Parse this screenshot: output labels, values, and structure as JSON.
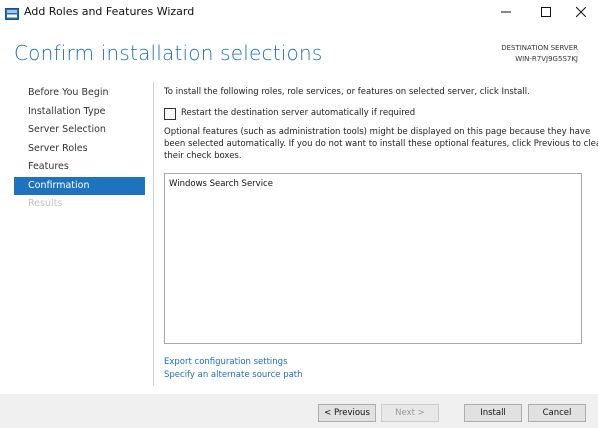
{
  "window": {
    "title": "Add Roles and Features Wizard"
  },
  "header": {
    "page_title": "Confirm installation selections",
    "destination_label": "DESTINATION SERVER",
    "destination_value": "WIN-R7VJ9G5S7KJ"
  },
  "nav": {
    "items": [
      {
        "label": "Before You Begin",
        "state": "normal"
      },
      {
        "label": "Installation Type",
        "state": "normal"
      },
      {
        "label": "Server Selection",
        "state": "normal"
      },
      {
        "label": "Server Roles",
        "state": "normal"
      },
      {
        "label": "Features",
        "state": "normal"
      },
      {
        "label": "Confirmation",
        "state": "active"
      },
      {
        "label": "Results",
        "state": "disabled"
      }
    ]
  },
  "main": {
    "intro": "To install the following roles, role services, or features on selected server, click Install.",
    "restart_label": "Restart the destination server automatically if required",
    "restart_checked": false,
    "note_lines": [
      "Optional features (such as administration tools) might be displayed on this page because they have",
      "been selected automatically. If you do not want to install these optional features, click Previous to clear",
      "their check boxes."
    ],
    "features": [
      "Windows Search Service"
    ],
    "export_link": "Export configuration settings",
    "source_link": "Specify an alternate source path"
  },
  "footer": {
    "previous": "< Previous",
    "next": "Next >",
    "install": "Install",
    "cancel": "Cancel"
  }
}
